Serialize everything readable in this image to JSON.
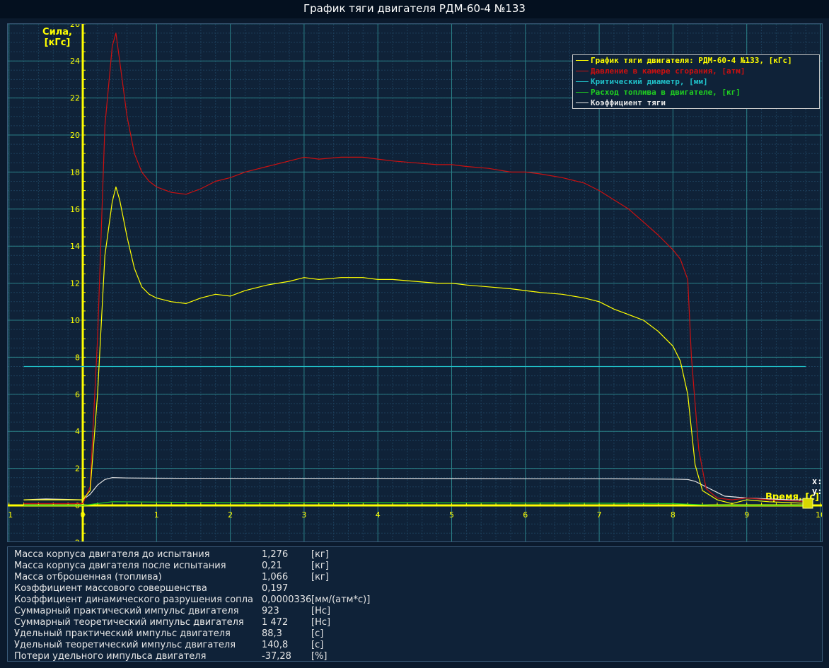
{
  "window": {
    "title": "График тяги двигателя РДМ-60-4 №133"
  },
  "colors": {
    "background": "#0f2238",
    "grid_major": "#2a7f86",
    "grid_minor": "#1c3e5a",
    "axis": "#ffff00",
    "thrust": "#ffff00",
    "pressure": "#cc1010",
    "critical_diameter": "#20c0c8",
    "fuel_flow": "#20d020",
    "thrust_coefficient": "#e8e8e8"
  },
  "chart_data": {
    "type": "line",
    "title": "График тяги двигателя РДМ-60-4 №133",
    "ylabel": [
      "Сила,",
      "[кГс]"
    ],
    "xlabel": "Время, [с]",
    "xlim": [
      -1,
      10
    ],
    "ylim": [
      -2,
      26
    ],
    "x_ticks": [
      -1,
      0,
      1,
      2,
      3,
      4,
      5,
      6,
      7,
      8,
      9,
      10
    ],
    "y_ticks": [
      -2,
      0,
      2,
      4,
      6,
      8,
      10,
      12,
      14,
      16,
      18,
      20,
      22,
      24,
      26
    ],
    "grid": true,
    "legend_position": "top-right",
    "cursor_labels": [
      "x:",
      "y:"
    ],
    "series": [
      {
        "name": "График тяги двигателя: РДМ-60-4 №133, [кГс]",
        "color": "#ffff00",
        "x": [
          -0.8,
          0,
          0.1,
          0.2,
          0.3,
          0.4,
          0.45,
          0.5,
          0.6,
          0.7,
          0.8,
          0.9,
          1.0,
          1.2,
          1.4,
          1.6,
          1.8,
          2.0,
          2.2,
          2.5,
          2.8,
          3.0,
          3.2,
          3.5,
          3.8,
          4.0,
          4.2,
          4.5,
          4.8,
          5.0,
          5.2,
          5.5,
          5.8,
          6.0,
          6.2,
          6.5,
          6.8,
          7.0,
          7.2,
          7.4,
          7.6,
          7.8,
          8.0,
          8.1,
          8.2,
          8.3,
          8.4,
          8.6,
          8.8,
          9.0,
          9.3,
          9.6,
          9.9
        ],
        "y": [
          0.3,
          0.3,
          0.8,
          6.0,
          13.5,
          16.4,
          17.2,
          16.5,
          14.5,
          12.8,
          11.8,
          11.4,
          11.2,
          11.0,
          10.9,
          11.2,
          11.4,
          11.3,
          11.6,
          11.9,
          12.1,
          12.3,
          12.2,
          12.3,
          12.3,
          12.2,
          12.2,
          12.1,
          12.0,
          12.0,
          11.9,
          11.8,
          11.7,
          11.6,
          11.5,
          11.4,
          11.2,
          11.0,
          10.6,
          10.3,
          10.0,
          9.4,
          8.6,
          7.8,
          6.0,
          2.2,
          0.8,
          0.3,
          0.1,
          0.3,
          0.2,
          0.15,
          0.1
        ]
      },
      {
        "name": "Давление в камере сгорания, [атм]",
        "color": "#cc1010",
        "x": [
          -0.8,
          0,
          0.1,
          0.2,
          0.3,
          0.4,
          0.45,
          0.5,
          0.6,
          0.7,
          0.8,
          0.9,
          1.0,
          1.2,
          1.4,
          1.6,
          1.8,
          2.0,
          2.2,
          2.5,
          2.8,
          3.0,
          3.2,
          3.5,
          3.8,
          4.0,
          4.2,
          4.5,
          4.8,
          5.0,
          5.2,
          5.5,
          5.8,
          6.0,
          6.2,
          6.5,
          6.8,
          7.0,
          7.2,
          7.4,
          7.6,
          7.8,
          8.0,
          8.1,
          8.2,
          8.25,
          8.35,
          8.45,
          8.6,
          8.8,
          9.0,
          9.3,
          9.6,
          9.9
        ],
        "y": [
          0.1,
          0.1,
          1.0,
          9.0,
          20.5,
          24.8,
          25.5,
          24.0,
          21.0,
          19.0,
          18.0,
          17.5,
          17.2,
          16.9,
          16.8,
          17.1,
          17.5,
          17.7,
          18.0,
          18.3,
          18.6,
          18.8,
          18.7,
          18.8,
          18.8,
          18.7,
          18.6,
          18.5,
          18.4,
          18.4,
          18.3,
          18.2,
          18.0,
          18.0,
          17.9,
          17.7,
          17.4,
          17.0,
          16.5,
          16.0,
          15.3,
          14.6,
          13.8,
          13.3,
          12.2,
          8.0,
          3.0,
          0.9,
          0.4,
          0.3,
          0.4,
          0.3,
          0.25,
          0.2
        ]
      },
      {
        "name": "Критический диаметр, [мм]",
        "color": "#20c0c8",
        "x": [
          -0.8,
          9.8
        ],
        "y": [
          7.5,
          7.5
        ]
      },
      {
        "name": "Расход топлива в двигателе, [кг]",
        "color": "#20d020",
        "x": [
          -0.8,
          0,
          0.2,
          0.4,
          1.0,
          2.0,
          4.0,
          6.0,
          7.0,
          8.0,
          8.3,
          8.6,
          9.9
        ],
        "y": [
          0.0,
          0.0,
          0.1,
          0.2,
          0.18,
          0.15,
          0.15,
          0.13,
          0.12,
          0.1,
          0.05,
          0.0,
          0.0
        ]
      },
      {
        "name": "Коэффициент тяги",
        "color": "#e8e8e8",
        "x": [
          -0.8,
          -0.5,
          0,
          0.1,
          0.2,
          0.3,
          0.4,
          0.6,
          1.0,
          2.0,
          3.0,
          4.0,
          5.0,
          6.0,
          7.0,
          7.5,
          8.0,
          8.2,
          8.3,
          8.5,
          8.7,
          9.0,
          9.3,
          9.6,
          9.9
        ],
        "y": [
          0.3,
          0.35,
          0.3,
          0.6,
          1.1,
          1.4,
          1.5,
          1.48,
          1.47,
          1.46,
          1.46,
          1.46,
          1.45,
          1.44,
          1.44,
          1.43,
          1.42,
          1.4,
          1.3,
          0.9,
          0.5,
          0.4,
          0.35,
          0.3,
          0.3
        ]
      }
    ]
  },
  "info": {
    "rows": [
      {
        "label": "Масса корпуса двигателя до испытания",
        "value": "1,276",
        "unit": "[кг]"
      },
      {
        "label": "Масса корпуса двигателя после испытания",
        "value": "0,21",
        "unit": "[кг]"
      },
      {
        "label": "Масса отброшенная (топлива)",
        "value": "1,066",
        "unit": "[кг]"
      },
      {
        "label": "Коэффициент массового совершенства",
        "value": "0,197",
        "unit": ""
      },
      {
        "label": "Коэффициент динамического разрушения сопла",
        "value": "0,0000336",
        "unit": "[мм/(атм*с)]"
      },
      {
        "label": "Суммарный практический импульс двигателя",
        "value": "923",
        "unit": "[Нс]"
      },
      {
        "label": "Суммарный теоретический импульс двигателя",
        "value": "1 472",
        "unit": "[Нс]"
      },
      {
        "label": "Удельный практический импульс двигателя",
        "value": "88,3",
        "unit": "[с]"
      },
      {
        "label": "Удельный теоретический импульс двигателя",
        "value": "140,8",
        "unit": "[с]"
      },
      {
        "label": "Потери удельного импульса двигателя",
        "value": "-37,28",
        "unit": "[%]"
      }
    ]
  }
}
